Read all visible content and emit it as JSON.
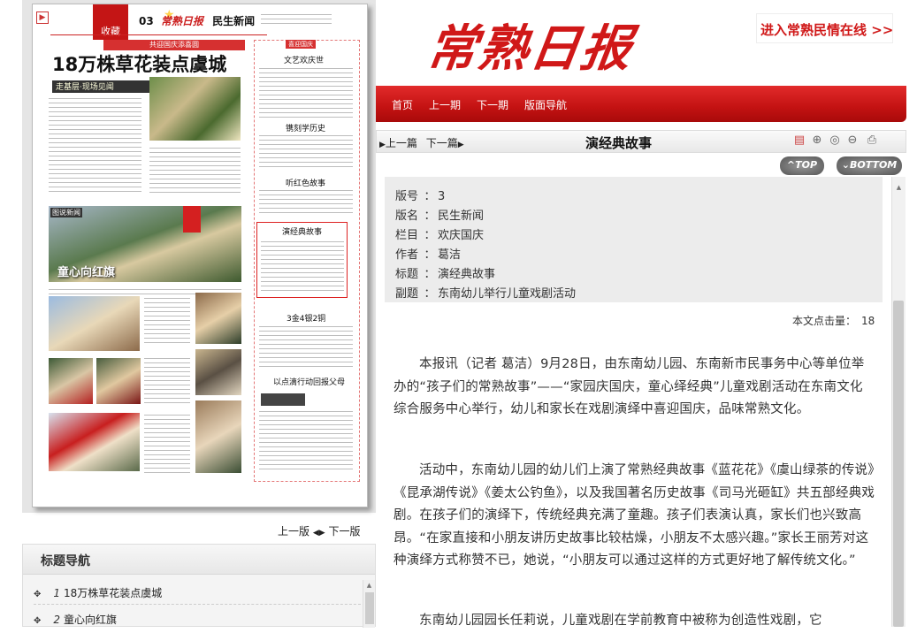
{
  "header": {
    "logo_text": "常熟日报",
    "top_link": "进入常熟民情在线 >>",
    "nav": [
      "首页",
      "上一期",
      "下一期",
      "版面导航"
    ]
  },
  "paper_thumb": {
    "collect_label": "收藏",
    "page_no": "03",
    "masthead": "常熟日报",
    "section": "民生新闻",
    "banner": "共迎国庆添喜圆",
    "headline": "18万株草花装点虞城",
    "sub_banner": "走基层·现场见闻",
    "photo_caption": "童心向红旗",
    "side_heads": [
      "文艺欢庆世",
      "镌刻学历史",
      "听红色故事",
      "演经典故事",
      "3金4银2铜",
      "以点滴行动回报父母"
    ],
    "corner_label": "喜迎国庆",
    "photo_tag": "图说新闻"
  },
  "pager": {
    "prev": "上一版",
    "next": "下一版"
  },
  "title_nav": {
    "heading": "标题导航",
    "items": [
      {
        "num": "1",
        "title": "18万株草花装点虞城"
      },
      {
        "num": "2",
        "title": "童心向红旗"
      }
    ]
  },
  "article_bar": {
    "prev": "上一篇",
    "next": "下一篇",
    "title": "演经典故事",
    "top_label": "TOP",
    "bottom_label": "BOTTOM"
  },
  "meta": {
    "rows": [
      {
        "k": "版号",
        "v": "3"
      },
      {
        "k": "版名",
        "v": "民生新闻"
      },
      {
        "k": "栏目",
        "v": "欢庆国庆"
      },
      {
        "k": "作者",
        "v": "葛洁"
      },
      {
        "k": "标题",
        "v": "演经典故事"
      },
      {
        "k": "副题",
        "v": "东南幼儿举行儿童戏剧活动"
      }
    ],
    "separator": "："
  },
  "hits": {
    "label": "本文点击量：",
    "value": "18"
  },
  "body": [
    "本报讯（记者 葛洁）9月28日，由东南幼儿园、东南新市民事务中心等单位举办的“孩子们的常熟故事”——“家园庆国庆，童心绎经典”儿童戏剧活动在东南文化综合服务中心举行，幼儿和家长在戏剧演绎中喜迎国庆，品味常熟文化。",
    "活动中，东南幼儿园的幼儿们上演了常熟经典故事《蓝花花》《虞山绿茶的传说》《昆承湖传说》《姜太公钓鱼》，以及我国著名历史故事《司马光砸缸》共五部经典戏剧。在孩子们的演绎下，传统经典充满了童趣。孩子们表演认真，家长们也兴致高昂。“在家直接和小朋友讲历史故事比较枯燥，小朋友不太感兴趣。”家长王丽芳对这种演绎方式称赞不已，她说，“小朋友可以通过这样的方式更好地了解传统文化。”",
    "东南幼儿园园长任莉说，儿童戏剧在学前教育中被称为创造性戏剧，它"
  ],
  "colors": {
    "brand_red": "#d01818",
    "band_red": "#c31212"
  }
}
